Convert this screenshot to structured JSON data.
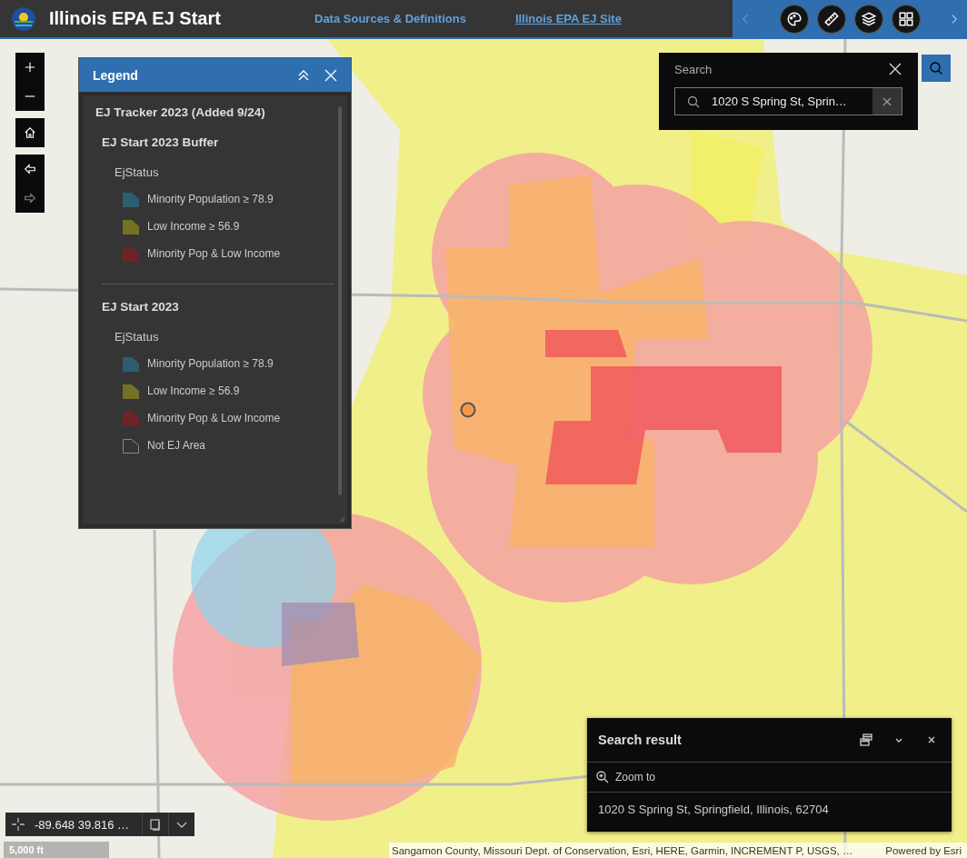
{
  "header": {
    "title": "Illinois EPA EJ Start",
    "links": [
      {
        "label": "Data Sources & Definitions",
        "underlined": false
      },
      {
        "label": "Illinois EPA EJ Site",
        "underlined": true
      }
    ]
  },
  "legend": {
    "title": "Legend",
    "group": "EJ Tracker 2023 (Added 9/24)",
    "layers": [
      {
        "title": "EJ Start 2023 Buffer",
        "field": "EjStatus",
        "items": [
          {
            "label": "Minority Population ≥ 78.9",
            "kind": "fill",
            "color": "#2c5e70"
          },
          {
            "label": "Low Income ≥ 56.9",
            "kind": "fill",
            "color": "#737124"
          },
          {
            "label": "Minority Pop & Low Income",
            "kind": "fill",
            "color": "#6e2427"
          }
        ]
      },
      {
        "title": "EJ Start 2023",
        "field": "EjStatus",
        "items": [
          {
            "label": "Minority Population ≥ 78.9",
            "kind": "fill",
            "color": "#2c5e70"
          },
          {
            "label": "Low Income ≥ 56.9",
            "kind": "fill",
            "color": "#737124"
          },
          {
            "label": "Minority Pop & Low Income",
            "kind": "fill",
            "color": "#6e2427"
          },
          {
            "label": "Not EJ Area",
            "kind": "outline"
          }
        ]
      }
    ]
  },
  "search": {
    "title": "Search",
    "value": "1020 S Spring St, Sprin…"
  },
  "result": {
    "title": "Search result",
    "action": "Zoom to",
    "address": "1020 S Spring St, Springfield, Illinois, 62704"
  },
  "coordinates": "-89.648 39.816 …",
  "scale": "5,000 ft",
  "attribution": {
    "sources": "Sangamon County, Missouri Dept. of Conservation, Esri, HERE, Garmin, INCREMENT P, USGS, …",
    "powered": "Powered by Esri"
  }
}
